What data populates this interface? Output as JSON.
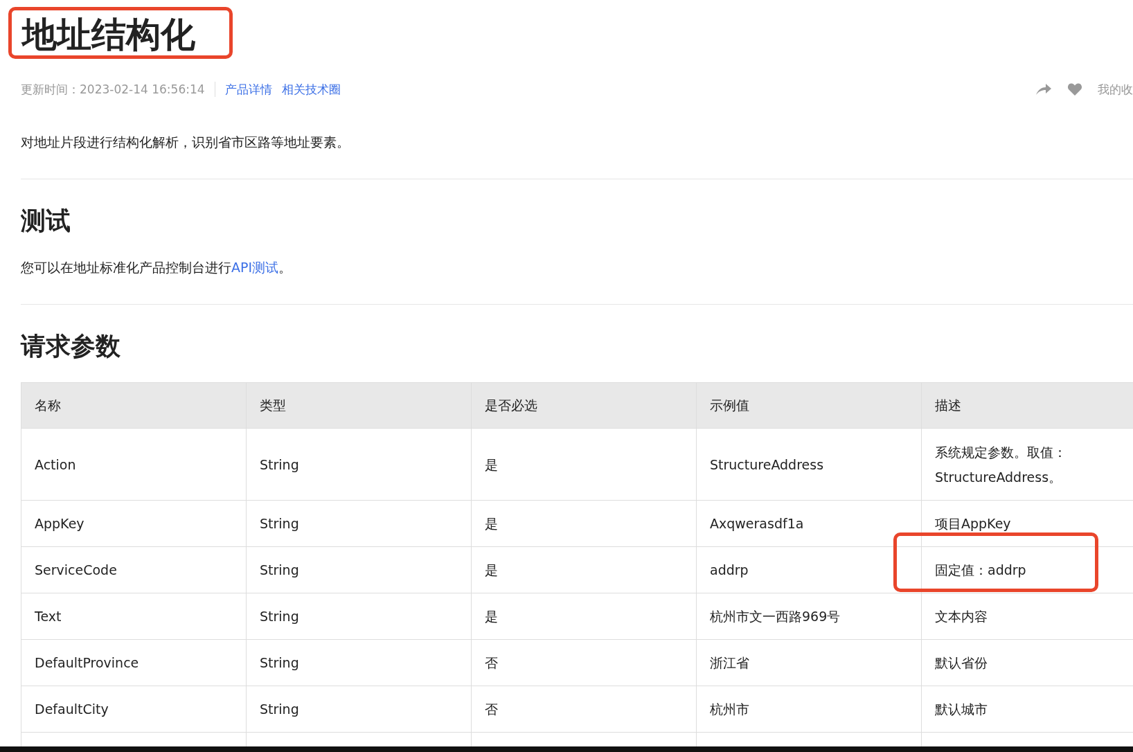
{
  "title": "地址结构化",
  "meta": {
    "updated": "更新时间：2023-02-14 16:56:14",
    "links": [
      "产品详情",
      "相关技术圈"
    ],
    "favorites": "我的收"
  },
  "description": "对地址片段进行结构化解析，识别省市区路等地址要素。",
  "test_section": {
    "heading": "测试",
    "text": "您可以在地址标准化产品控制台进行",
    "link": "API测试",
    "end": "。"
  },
  "params_section": {
    "heading": "请求参数",
    "table": {
      "columns": [
        "名称",
        "类型",
        "是否必选",
        "示例值",
        "描述"
      ],
      "rows": [
        [
          "Action",
          "String",
          "是",
          "StructureAddress",
          "系统规定参数。取值：StructureAddress。"
        ],
        [
          "AppKey",
          "String",
          "是",
          "Axqwerasdf1a",
          "项目AppKey"
        ],
        [
          "ServiceCode",
          "String",
          "是",
          "addrp",
          "固定值：addrp"
        ],
        [
          "Text",
          "String",
          "是",
          "杭州市文一西路969号",
          "文本内容"
        ],
        [
          "DefaultProvince",
          "String",
          "否",
          "浙江省",
          "默认省份"
        ],
        [
          "DefaultCity",
          "String",
          "否",
          "杭州市",
          "默认城市"
        ]
      ]
    }
  }
}
